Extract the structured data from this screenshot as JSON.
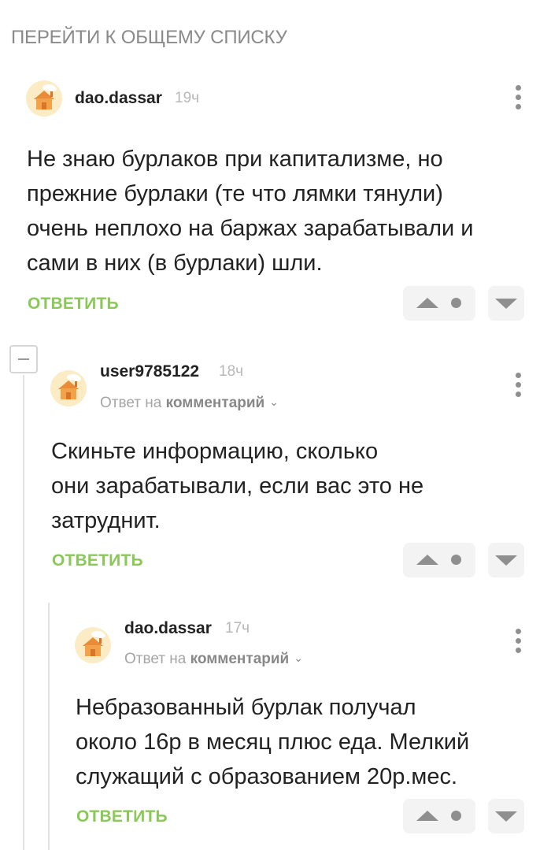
{
  "top_link": "ПЕРЕЙТИ К ОБЩЕМУ СПИСКУ",
  "reply_label": "ОТВЕТИТЬ",
  "reply_to_prefix": "Ответ на",
  "reply_to_link": "комментарий",
  "comments": [
    {
      "username": "dao.dassar",
      "time": "19ч",
      "text_lines": [
        "Не знаю бурлаков при капитализме, но",
        "прежние бурлаки (те что лямки тянули)",
        "очень неплохо на баржах зарабатывали и",
        "сами в них (в бурлаки) шли."
      ]
    },
    {
      "username": "user9785122",
      "time": "18ч",
      "text_lines": [
        "Скиньте информацию, сколько",
        "они зарабатывали, если вас это не",
        "затруднит."
      ]
    },
    {
      "username": "dao.dassar",
      "time": "17ч",
      "text_lines": [
        "Небразованный бурлак получал",
        "около 16р в месяц плюс еда. Мелкий",
        "служащий с образованием 20р.мес."
      ]
    }
  ],
  "colors": {
    "accent_green": "#8ac858",
    "muted": "#8f8f8f",
    "avatar_bg": "#fcecc6"
  },
  "icons": [
    "avatar-house-icon",
    "more-options-icon",
    "upvote-icon",
    "rating-dot-icon",
    "downvote-icon",
    "collapse-icon",
    "chevron-down-icon"
  ]
}
